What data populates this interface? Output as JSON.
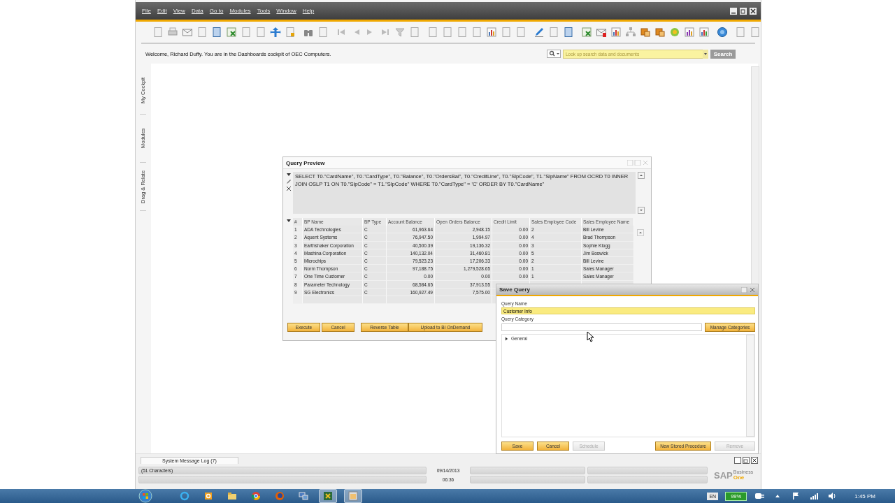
{
  "window": {
    "menu": [
      "File",
      "Edit",
      "View",
      "Data",
      "Go to",
      "Modules",
      "Tools",
      "Window",
      "Help"
    ]
  },
  "welcome": "Welcome, Richard Duffy. You are in the Dashboards cockpit of OEC Computers.",
  "search": {
    "placeholder": "Look up search data and documents",
    "button": "Search"
  },
  "sidebar": {
    "tabs": [
      "My Cockpit",
      "Modules",
      "Drag & Relate"
    ]
  },
  "query_preview": {
    "title": "Query Preview",
    "sql": "SELECT T0.\"CardName\", T0.\"CardType\", T0.\"Balance\", T0.\"OrdersBal\", T0.\"CreditLine\", T0.\"SlpCode\", T1.\"SlpName\" FROM OCRD T0  INNER JOIN OSLP T1 ON T0.\"SlpCode\" = T1.\"SlpCode\" WHERE T0.\"CardType\" = 'C' ORDER BY T0.\"CardName\"",
    "columns": [
      "#",
      "BP Name",
      "BP Type",
      "Account Balance",
      "Open Orders Balance",
      "Credit Limit",
      "Sales Employee Code",
      "Sales Employee Name"
    ],
    "rows": [
      [
        "1",
        "ADA Technologies",
        "C",
        "61,963.64",
        "2,948.15",
        "0.00",
        "2",
        "Bill Levine"
      ],
      [
        "2",
        "Aquent Systems",
        "C",
        "76,947.50",
        "1,994.97",
        "0.00",
        "4",
        "Brad Thompson"
      ],
      [
        "3",
        "Earthshaker Corporation",
        "C",
        "40,500.39",
        "19,136.32",
        "0.00",
        "3",
        "Sophie Klogg"
      ],
      [
        "4",
        "Mashina Corporation",
        "C",
        "140,132.04",
        "31,460.81",
        "0.00",
        "5",
        "Jim Boswick"
      ],
      [
        "5",
        "Microchips",
        "C",
        "79,523.23",
        "17,206.33",
        "0.00",
        "2",
        "Bill Levine"
      ],
      [
        "6",
        "Norm Thompson",
        "C",
        "97,188.75",
        "1,279,528.65",
        "0.00",
        "1",
        "Sales Manager"
      ],
      [
        "7",
        "One Time Customer",
        "C",
        "0.00",
        "0.00",
        "0.00",
        "1",
        "Sales Manager"
      ],
      [
        "8",
        "Parameter Technology",
        "C",
        "68,584.65",
        "37,913.55"
      ],
      [
        "9",
        "SG Electronics",
        "C",
        "160,927.49",
        "7,575.00"
      ]
    ],
    "buttons": [
      "Execute",
      "Cancel",
      "Reverse Table",
      "Upload to BI OnDemand"
    ]
  },
  "save_query": {
    "title": "Save Query",
    "name_label": "Query Name",
    "name_value": "Customer Info",
    "category_label": "Query Category",
    "manage_button": "Manage Categories",
    "tree": [
      {
        "label": "General",
        "expanded": false
      }
    ],
    "buttons_left": [
      {
        "label": "Save",
        "disabled": false
      },
      {
        "label": "Cancel",
        "disabled": false
      },
      {
        "label": "Schedule",
        "disabled": true
      }
    ],
    "buttons_right": [
      {
        "label": "New Stored Procedure",
        "disabled": false
      },
      {
        "label": "Remove",
        "disabled": true
      }
    ]
  },
  "message_log": {
    "tab": "System Message Log (7)"
  },
  "status_bar": {
    "message": "(51 Characters)",
    "date": "09/14/2013",
    "time": "06:36"
  },
  "logo": {
    "brand": "SAP",
    "line_1": "Business",
    "line_2": "One"
  },
  "taskbar": {
    "apps": [
      {
        "kind": "ie",
        "active": false
      },
      {
        "kind": "outlook",
        "active": false
      },
      {
        "kind": "folder",
        "active": false
      },
      {
        "kind": "chrome",
        "active": false
      },
      {
        "kind": "firefox",
        "active": false
      },
      {
        "kind": "network",
        "active": false
      },
      {
        "kind": "sap",
        "active": true
      },
      {
        "kind": "query",
        "active": true
      }
    ],
    "language": "EN",
    "battery": "99%",
    "clock": "1:45 PM"
  }
}
